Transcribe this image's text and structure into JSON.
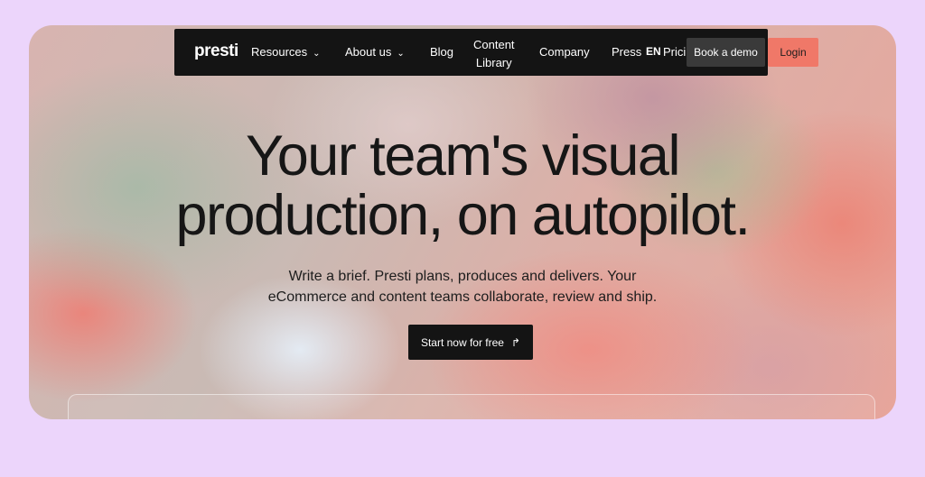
{
  "nav": {
    "logo": "presti",
    "items": [
      {
        "label": "Resources",
        "dropdown": true
      },
      {
        "label": "About us",
        "dropdown": true
      },
      {
        "label": "Blog"
      },
      {
        "label_line1": "Content",
        "label_line2": "Library"
      },
      {
        "label": "Company"
      },
      {
        "label": "Press"
      }
    ],
    "language": "EN",
    "pricing": "Pricing",
    "book_demo": "Book a demo",
    "login": "Login"
  },
  "hero": {
    "title_line1": "Your team's visual",
    "title_line2": "production, on autopilot.",
    "subtitle_line1": "Write a brief. Presti plans, produces and delivers. Your",
    "subtitle_line2": "eCommerce and content teams collaborate, review and ship.",
    "cta_label": "Start now for free"
  },
  "icons": {
    "chevron": "chevron-down-icon",
    "cta_arrow": "arrow-turn-icon"
  },
  "colors": {
    "page_bg": "#ecd5fb",
    "nav_bg": "#141414",
    "login_bg": "#f07868",
    "demo_bg": "#3a3a3a"
  }
}
